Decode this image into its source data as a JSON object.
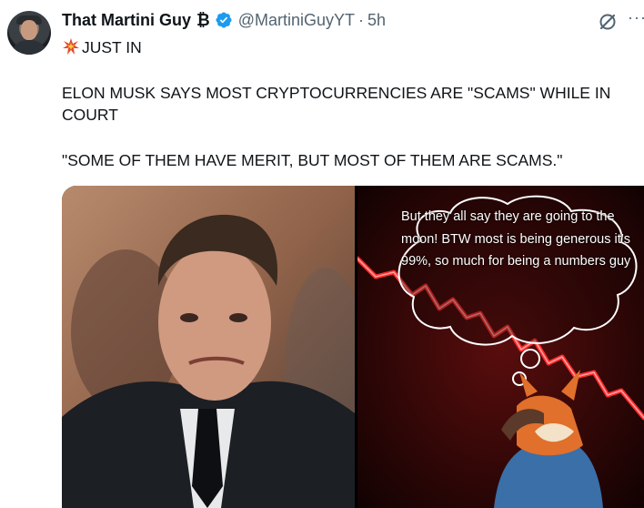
{
  "tweet": {
    "author_name": "That Martini Guy",
    "author_symbol": "₿",
    "handle": "@MartiniGuyYT",
    "separator": "·",
    "time": "5h",
    "more_label": "···",
    "line1": "JUST IN",
    "line2": "ELON MUSK SAYS MOST CRYPTOCURRENCIES ARE \"SCAMS\" WHILE IN COURT",
    "line3": "\"SOME OF THEM HAVE MERIT, BUT MOST OF THEM ARE SCAMS.\""
  },
  "media": {
    "thought_bubble_text": "But they all say they are going to the moon!  BTW most is being generous it’s 99%, so much for being a numbers guy"
  },
  "colors": {
    "verified": "#1d9bf0",
    "secondary_text": "#536471",
    "primary_text": "#0f1419",
    "chart_red": "#ff2a2a"
  },
  "icons": {
    "verified": "verified-badge-icon",
    "grok": "grok-icon",
    "more": "more-icon",
    "emoji": "collision-emoji-icon"
  }
}
